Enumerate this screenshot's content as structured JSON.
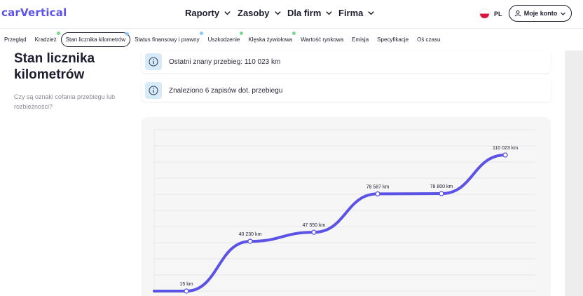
{
  "header": {
    "logo": "carVertical",
    "nav": [
      {
        "label": "Raporty"
      },
      {
        "label": "Zasoby"
      },
      {
        "label": "Dla firm"
      },
      {
        "label": "Firma"
      }
    ],
    "language": "PL",
    "account_label": "Moje konto"
  },
  "tabs": [
    {
      "label": "Przegląd",
      "dot": ""
    },
    {
      "label": "Kradzież",
      "dot": "#7bd88f"
    },
    {
      "label": "Stan licznika kilometrów",
      "dot": "#8ec5f5",
      "active": true
    },
    {
      "label": "Status finansowy i prawny",
      "dot": "#8ec5f5"
    },
    {
      "label": "Uszkodzenie",
      "dot": "#7bd88f"
    },
    {
      "label": "Klęska żywiołowa",
      "dot": "#7bd88f"
    },
    {
      "label": "Wartość rynkowa",
      "dot": ""
    },
    {
      "label": "Emisja",
      "dot": ""
    },
    {
      "label": "Specyfikacje",
      "dot": ""
    },
    {
      "label": "Oś czasu",
      "dot": ""
    }
  ],
  "section": {
    "title": "Stan licznika kilometrów",
    "subtitle": "Czy są oznaki cofania przebiegu lub rozbieżności?"
  },
  "cards": [
    {
      "text": "Ostatni znany przebieg: 110 023 km"
    },
    {
      "text": "Znaleziono 6 zapisów dot. przebiegu"
    }
  ],
  "colors": {
    "brand": "#5b52e6",
    "line": "#5b52e6",
    "info_bg": "#d6eaf8",
    "green_dot": "#7bd88f",
    "blue_dot": "#8ec5f5"
  },
  "chart_data": {
    "type": "line",
    "series": [
      {
        "values": [
          15,
          40230,
          47550,
          78587,
          78800,
          110023
        ]
      }
    ],
    "point_labels": [
      "15 km",
      "40 230 km",
      "47 550 km",
      "78 587 km",
      "78 800 km",
      "110 023 km"
    ],
    "unit": "km",
    "grid": true
  }
}
